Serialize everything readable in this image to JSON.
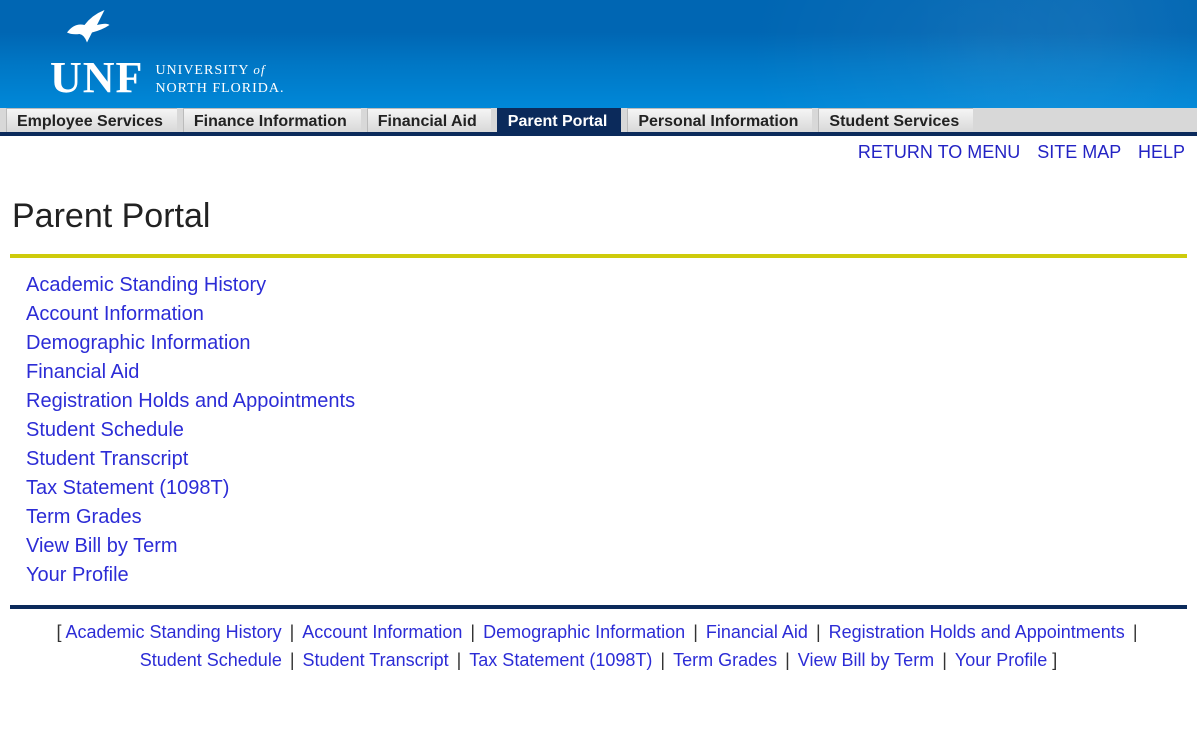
{
  "brand": {
    "short": "UNF",
    "line1_a": "UNIVERSITY ",
    "line1_b": "of",
    "line2": "NORTH FLORIDA."
  },
  "tabs": [
    {
      "label": "Employee Services",
      "active": false
    },
    {
      "label": "Finance Information",
      "active": false
    },
    {
      "label": "Financial Aid",
      "active": false
    },
    {
      "label": "Parent Portal",
      "active": true
    },
    {
      "label": "Personal Information",
      "active": false
    },
    {
      "label": "Student Services",
      "active": false
    }
  ],
  "util": {
    "return": "RETURN TO MENU",
    "sitemap": "SITE MAP",
    "help": "HELP"
  },
  "page_title": "Parent Portal",
  "links": [
    "Academic Standing History",
    "Account Information",
    "Demographic Information",
    "Financial Aid",
    "Registration Holds and Appointments",
    "Student Schedule",
    "Student Transcript",
    "Tax Statement (1098T)",
    "Term Grades",
    "View Bill by Term",
    "Your Profile"
  ],
  "footer_open": "[ ",
  "footer_close": " ]",
  "footer_sep": " | "
}
